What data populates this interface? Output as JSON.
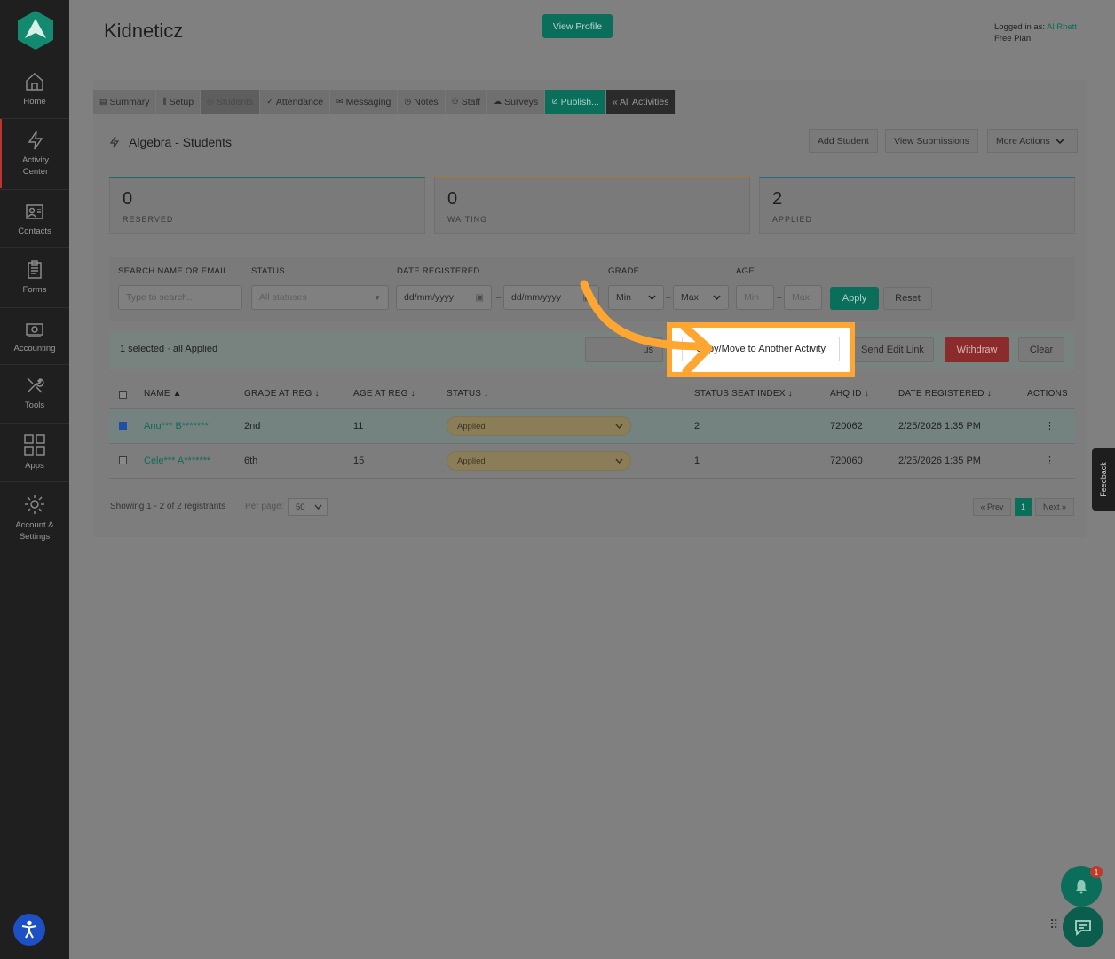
{
  "app": {
    "title": "Kidneticz",
    "view_profile": "View Profile",
    "logged_in_label": "Logged in as:",
    "user": "Al Rhett",
    "plan": "Free Plan"
  },
  "sidebar": {
    "items": [
      {
        "label": "Home"
      },
      {
        "label": "Activity Center"
      },
      {
        "label": "Contacts"
      },
      {
        "label": "Forms"
      },
      {
        "label": "Accounting"
      },
      {
        "label": "Tools"
      },
      {
        "label": "Apps"
      },
      {
        "label": "Account & Settings"
      }
    ]
  },
  "tabs": [
    {
      "label": "Summary"
    },
    {
      "label": "Setup"
    },
    {
      "label": "Students"
    },
    {
      "label": "Attendance"
    },
    {
      "label": "Messaging"
    },
    {
      "label": "Notes"
    },
    {
      "label": "Staff"
    },
    {
      "label": "Surveys"
    },
    {
      "label": "Publish..."
    },
    {
      "label": "« All Activities"
    }
  ],
  "section": {
    "title": "Algebra - Students",
    "add_student": "Add Student",
    "view_submissions": "View Submissions",
    "more_actions": "More Actions"
  },
  "stats": [
    {
      "value": "0",
      "label": "RESERVED",
      "color": "#1a7a6a"
    },
    {
      "value": "0",
      "label": "WAITING",
      "color": "#c08a30"
    },
    {
      "value": "2",
      "label": "APPLIED",
      "color": "#2a6a8a"
    }
  ],
  "filters": {
    "search_label": "SEARCH NAME OR EMAIL",
    "search_placeholder": "Type to search...",
    "status_label": "STATUS",
    "status_value": "All statuses",
    "date_label": "DATE REGISTERED",
    "date_from": "dd/mm/yyyy",
    "date_to": "dd/mm/yyyy",
    "grade_label": "GRADE",
    "grade_min": "Min",
    "grade_max": "Max",
    "age_label": "AGE",
    "age_min": "Min",
    "age_max": "Max",
    "apply": "Apply",
    "reset": "Reset"
  },
  "selection": {
    "text": "1 selected · all Applied",
    "status_btn_partial": "us",
    "copy_move": "Copy/Move to Another Activity",
    "send_edit_link": "Send Edit Link",
    "withdraw": "Withdraw",
    "clear": "Clear"
  },
  "table": {
    "headers": [
      "NAME ▲",
      "GRADE AT REG ↕",
      "AGE AT REG ↕",
      "STATUS ↕",
      "STATUS SEAT INDEX ↕",
      "AHQ ID ↕",
      "DATE REGISTERED ↕",
      "ACTIONS"
    ],
    "rows": [
      {
        "name": "Anu*** B*******",
        "grade": "2nd",
        "age": "11",
        "status": "Applied",
        "seat": "2",
        "id": "720062",
        "date": "2/25/2026 1:35 PM",
        "actions": "⋮",
        "checked": true
      },
      {
        "name": "Cele*** A*******",
        "grade": "6th",
        "age": "15",
        "status": "Applied",
        "seat": "1",
        "id": "720060",
        "date": "2/25/2026 1:35 PM",
        "actions": "⋮",
        "checked": false
      }
    ]
  },
  "footer": {
    "showing": "Showing 1 - 2 of 2 registrants",
    "per_page_label": "Per page:",
    "per_page": "50",
    "prev": "« Prev",
    "page": "1",
    "next": "Next »"
  },
  "widgets": {
    "feedback": "Feedback",
    "notification_count": "1"
  }
}
